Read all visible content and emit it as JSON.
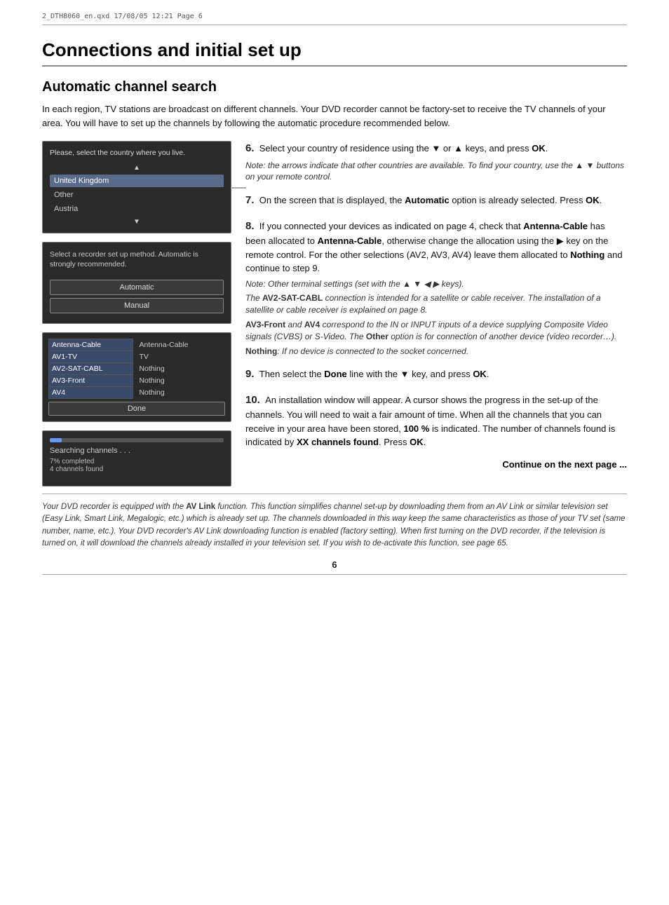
{
  "file_header": "2_DTH8060_en.qxd  17/08/05  12:21  Page 6",
  "page_title": "Connections and initial set up",
  "section_heading": "Automatic channel search",
  "intro": "In each region, TV stations are broadcast on different channels. Your DVD recorder cannot be factory-set to receive the TV channels of your area. You will have to set up the channels by following the automatic procedure recommended below.",
  "screen1": {
    "title": "Please, select the country where you live.",
    "items": [
      {
        "label": "United Kingdom",
        "selected": true
      },
      {
        "label": "Other",
        "selected": false
      },
      {
        "label": "Austria",
        "selected": false
      }
    ]
  },
  "screen2": {
    "text": "Select a recorder set up method. Automatic is strongly recommended.",
    "buttons": [
      "Automatic",
      "Manual"
    ]
  },
  "screen3": {
    "rows": [
      {
        "label": "Antenna-Cable",
        "value": "Antenna-Cable"
      },
      {
        "label": "AV1-TV",
        "value": "TV"
      },
      {
        "label": "AV2-SAT-CABL",
        "value": "Nothing"
      },
      {
        "label": "AV3-Front",
        "value": "Nothing"
      },
      {
        "label": "AV4",
        "value": "Nothing"
      }
    ],
    "done_label": "Done"
  },
  "screen4": {
    "title": "Searching channels . . .",
    "progress_percent": 7,
    "status1": "7% completed",
    "status2": "4 channels found"
  },
  "steps": [
    {
      "number": "6.",
      "text": "Select your country of residence using the ▼ or ▲ keys, and press ",
      "bold_end": "OK",
      "note": "Note: the arrows indicate that other countries are available. To find your country, use the ▲ ▼ buttons on your remote control."
    },
    {
      "number": "7.",
      "text": "On the screen that is displayed, the ",
      "bold_word": "Automatic",
      "text2": " option is already selected. Press ",
      "bold_end": "OK",
      "text3": "."
    },
    {
      "number": "8.",
      "text_parts": [
        "If you connected your devices as indicated on page 4, check that ",
        "Antenna-Cable",
        " has been allocated to ",
        "Antenna-Cable",
        ", otherwise change the allocation using the ▶ key on the remote control. For the other selections (AV2, AV3, AV4) leave them allocated to ",
        "Nothing",
        " and continue to step 9."
      ],
      "note1": "Note: Other terminal settings (set with the ▲ ▼ ◀ ▶ keys).",
      "note2": "The AV2-SAT-CABL connection is intended for a satellite or cable receiver. The installation of a satellite or cable receiver is explained on page 8.",
      "note3": "AV3-Front and AV4 correspond to the IN or INPUT inputs of a device supplying Composite Video signals (CVBS) or S-Video. The Other option is for connection of another device (video recorder…).",
      "note4": "Nothing: If no device is connected to the socket concerned."
    },
    {
      "number": "9.",
      "text": "Then select the ",
      "bold_word": "Done",
      "text2": " line with the ▼ key, and press ",
      "bold_end": "OK",
      "text3": "."
    },
    {
      "number": "10.",
      "text_parts": [
        "An installation window will appear. A cursor shows the progress in the set-up of the channels. You will need to wait a fair amount of time. When all the channels that you can receive in your area have been stored, ",
        "100 %",
        " is indicated. The number of channels found is indicated by ",
        "XX channels found",
        ". Press ",
        "OK",
        "."
      ]
    }
  ],
  "continue_text": "Continue on the next page ...",
  "footer_note": "Your DVD recorder is equipped with the AV Link function. This function simplifies channel set-up by downloading them from an AV Link or similar television set (Easy Link, Smart Link, Megalogic, etc.) which is already set up. The channels downloaded in this way keep the same characteristics as those of your TV set (same number, name, etc.). Your DVD recorder's AV Link downloading function is enabled (factory setting). When first turning on the DVD recorder, if the television is turned on, it will download the channels already installed in your television set. If you wish to de-activate this function, see page 65.",
  "page_number": "6"
}
